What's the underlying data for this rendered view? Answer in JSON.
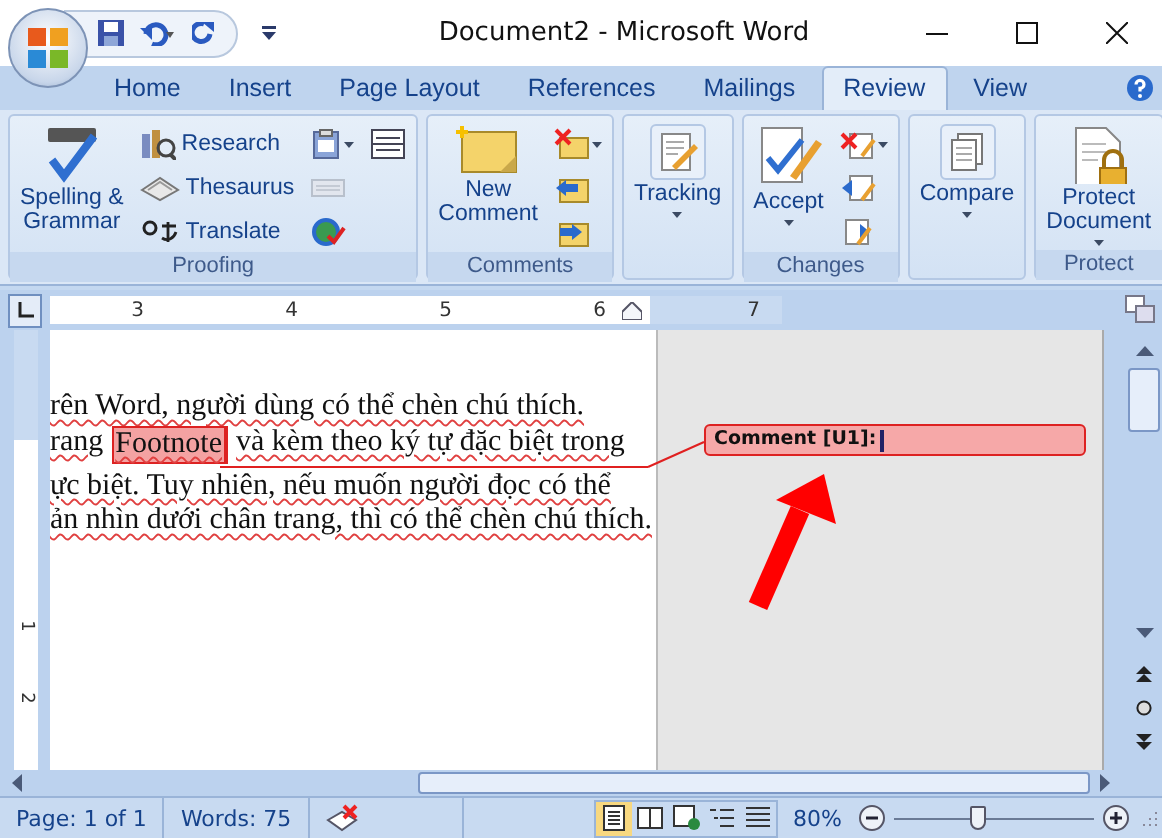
{
  "window": {
    "title": "Document2 - Microsoft Word"
  },
  "tabs": [
    {
      "label": "Home",
      "selected": false
    },
    {
      "label": "Insert",
      "selected": false
    },
    {
      "label": "Page Layout",
      "selected": false
    },
    {
      "label": "References",
      "selected": false
    },
    {
      "label": "Mailings",
      "selected": false
    },
    {
      "label": "Review",
      "selected": true
    },
    {
      "label": "View",
      "selected": false
    }
  ],
  "ribbon": {
    "groups": [
      {
        "label": "Proofing",
        "buttons": [
          {
            "kind": "large",
            "label": "Spelling &\nGrammar"
          },
          {
            "kind": "small",
            "label": "Research"
          },
          {
            "kind": "small",
            "label": "Thesaurus"
          },
          {
            "kind": "small",
            "label": "Translate"
          },
          {
            "kind": "icon",
            "dropdown": true
          },
          {
            "kind": "icon",
            "dropdown": false
          },
          {
            "kind": "icon",
            "dropdown": false
          },
          {
            "kind": "icon",
            "dropdown": false
          }
        ]
      },
      {
        "label": "Comments",
        "buttons": [
          {
            "kind": "large",
            "label": "New\nComment"
          },
          {
            "kind": "icon",
            "dropdown": true
          },
          {
            "kind": "icon",
            "dropdown": false
          },
          {
            "kind": "icon",
            "dropdown": false
          }
        ]
      },
      {
        "buttons": [
          {
            "kind": "large",
            "label": "Tracking",
            "dropdown": true
          }
        ]
      },
      {
        "label": "Changes",
        "buttons": [
          {
            "kind": "large",
            "label": "Accept",
            "dropdown": true
          },
          {
            "kind": "icon",
            "dropdown": true
          },
          {
            "kind": "icon",
            "dropdown": false
          },
          {
            "kind": "icon",
            "dropdown": false
          }
        ]
      },
      {
        "buttons": [
          {
            "kind": "large",
            "label": "Compare",
            "dropdown": true
          }
        ]
      },
      {
        "label": "Protect",
        "buttons": [
          {
            "kind": "large",
            "label": "Protect\nDocument",
            "dropdown": true
          }
        ]
      }
    ]
  },
  "ruler": {
    "horizontal": [
      "3",
      "4",
      "5",
      "6",
      "7"
    ],
    "vertical": [
      "1",
      "2"
    ]
  },
  "document": {
    "lines": [
      {
        "text": "rên Word, người dùng có thể chèn chú thích."
      },
      {
        "before": "rang",
        "anchor": "Footnote",
        "after": "và kèm theo ký tự đặc biệt trong"
      },
      {
        "text": "ực biệt. Tuy nhiên, nếu muốn người đọc có thể"
      },
      {
        "text": "ản nhìn dưới chân trang, thì có thể chèn chú thích."
      }
    ],
    "comment": {
      "label": "Comment [U1]:"
    }
  },
  "status_bar": {
    "page": "Page: 1 of 1",
    "words": "Words: 75",
    "views": [
      {
        "selected": true
      },
      {
        "selected": false
      },
      {
        "selected": false
      },
      {
        "selected": false
      },
      {
        "selected": false
      }
    ],
    "zoom": {
      "label": "80%",
      "level": 0.42
    }
  }
}
